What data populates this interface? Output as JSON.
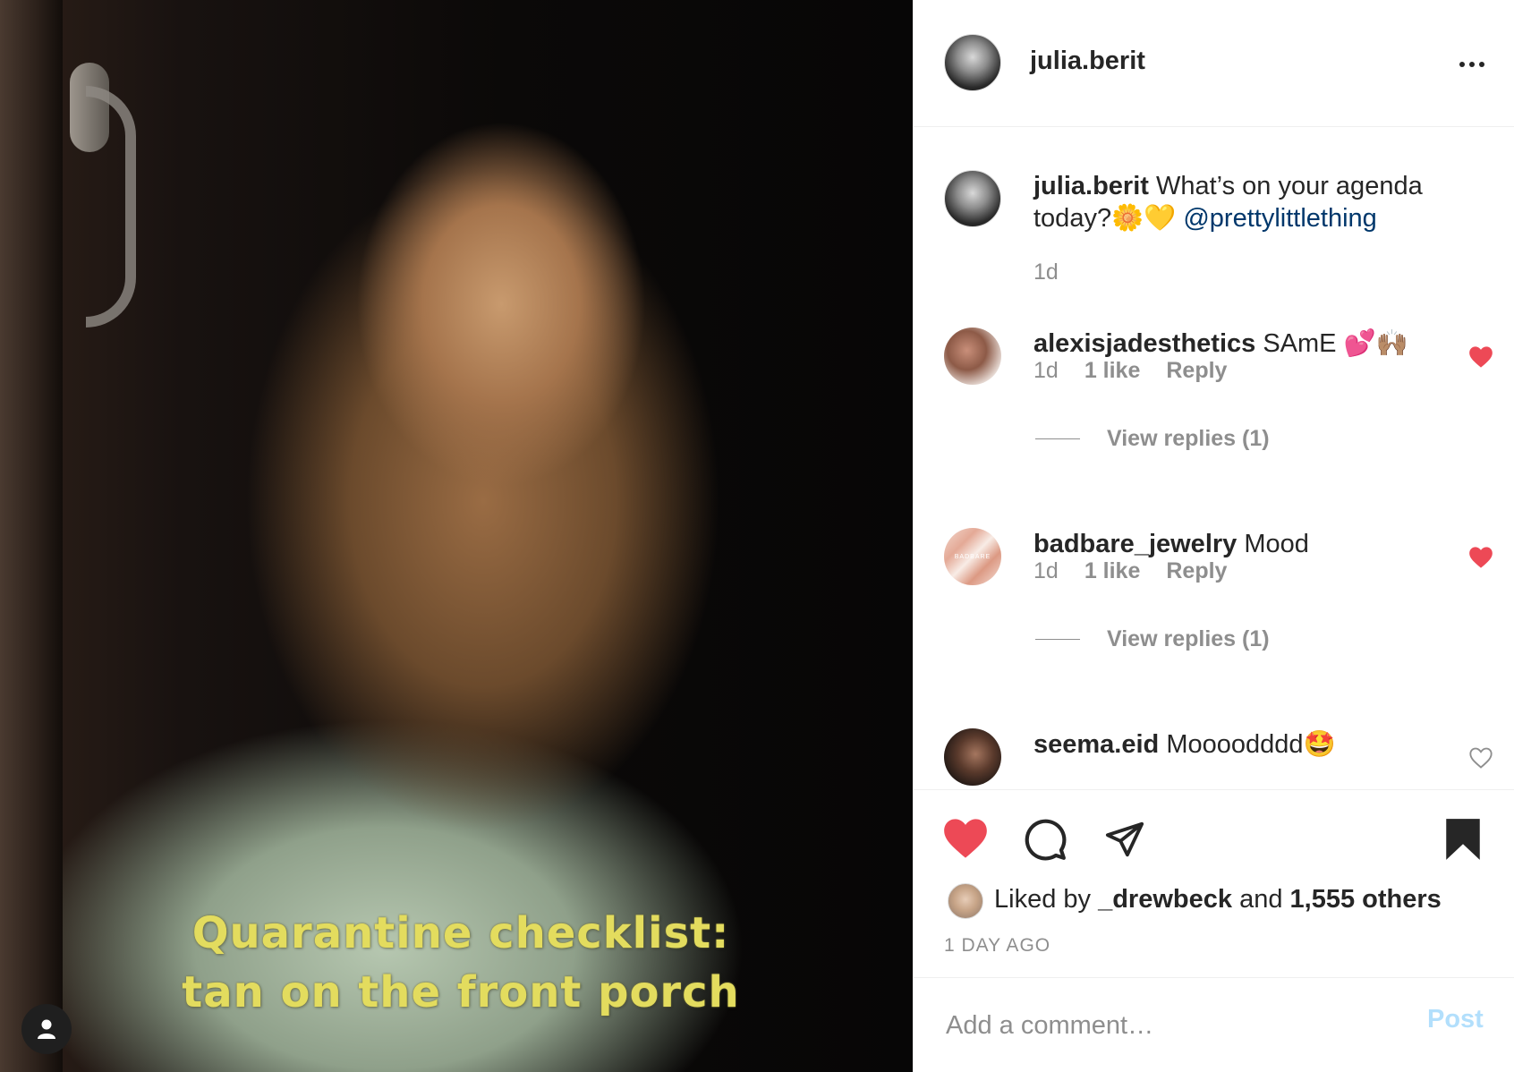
{
  "post": {
    "username": "julia.berit",
    "overlay_line1": "Quarantine checklist:",
    "overlay_line2": "tan on the front porch",
    "caption_text": "What’s on your agenda today?🌼💛",
    "caption_mention": "@prettylittlething",
    "caption_time": "1d"
  },
  "comments": [
    {
      "username": "alexisjadesthetics",
      "text": "SAmE 💕🙌🏽",
      "time": "1d",
      "likes": "1 like",
      "reply": "Reply",
      "view_replies": "View replies (1)",
      "liked": true
    },
    {
      "username": "badbare_jewelry",
      "text": "Mood",
      "time": "1d",
      "likes": "1 like",
      "reply": "Reply",
      "view_replies": "View replies (1)",
      "liked": true,
      "avatar_text": "BADBARE"
    },
    {
      "username": "seema.eid",
      "text": "Moooodddd🤩",
      "liked": false
    }
  ],
  "actions": {
    "liked_prefix": "Liked by",
    "liked_user": "_drewbeck",
    "liked_and": "and",
    "liked_others": "1,555 others",
    "time_ago": "1 DAY AGO"
  },
  "add_comment": {
    "placeholder": "Add a comment…",
    "post_label": "Post"
  },
  "colors": {
    "heart_red": "#ed4956",
    "link_blue": "#00376b",
    "post_disabled": "#b2dffc",
    "overlay_text": "#e3dc5e"
  },
  "icons": [
    "user-tag-icon",
    "more-options-icon",
    "heart-icon",
    "comment-icon",
    "share-icon",
    "bookmark-icon"
  ]
}
